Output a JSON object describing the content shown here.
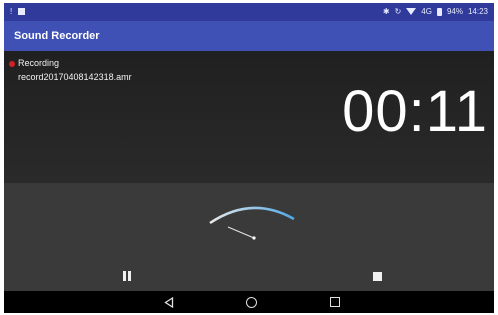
{
  "status_bar": {
    "left_icons": [
      "notification-icon",
      "image-icon"
    ],
    "network": "4G",
    "battery": "94%",
    "time": "14:23"
  },
  "app_bar": {
    "title": "Sound Recorder"
  },
  "recording": {
    "status": "Recording",
    "filename": "record20170408142318.amr",
    "elapsed": "00:11"
  },
  "controls": {
    "pause_icon": "pause-icon",
    "stop_icon": "stop-icon"
  },
  "navigation": [
    "back-icon",
    "home-icon",
    "recents-icon"
  ],
  "colors": {
    "app_bar": "#3f51b5",
    "status_bar": "#2f3a9a",
    "recording_dot": "#d42020",
    "meter_arc": "#4fa8e8"
  }
}
